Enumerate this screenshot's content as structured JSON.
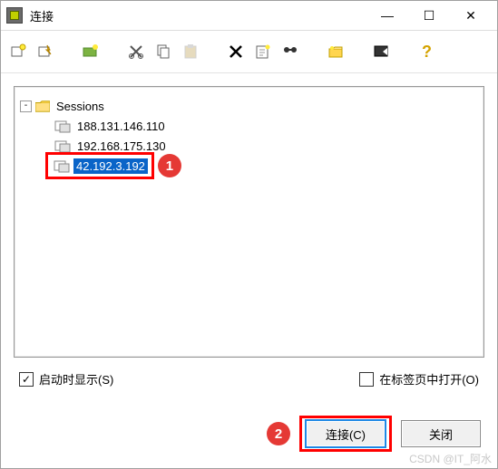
{
  "window": {
    "title": "连接"
  },
  "winbtns": {
    "min": "—",
    "max": "☐",
    "close": "✕"
  },
  "tree": {
    "root_label": "Sessions",
    "items": [
      "188.131.146.110",
      "192.168.175.130",
      "42.192.3.192"
    ],
    "selected_index": 2
  },
  "checkboxes": {
    "startup_show_label": "启动时显示(S)",
    "startup_show_checked": "✓",
    "open_in_tab_label": "在标签页中打开(O)"
  },
  "buttons": {
    "connect": "连接(C)",
    "close": "关闭"
  },
  "badges": {
    "one": "1",
    "two": "2"
  },
  "watermark": "CSDN @IT_阿水"
}
